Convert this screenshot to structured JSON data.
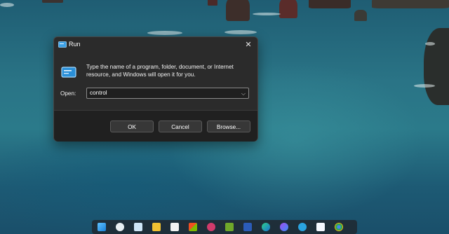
{
  "window": {
    "title": "Run",
    "close_glyph": "✕",
    "description": "Type the name of a program, folder, document, or Internet resource, and Windows will open it for you.",
    "open_label": "Open:",
    "open_value": "control",
    "dropdown_glyph": "⌵"
  },
  "buttons": {
    "ok": "OK",
    "cancel": "Cancel",
    "browse": "Browse..."
  },
  "taskbar": {
    "icons": [
      "start-icon",
      "weather-icon",
      "notepad-icon",
      "file-explorer-icon",
      "snipping-icon",
      "store-icon",
      "photos-icon",
      "vim-icon",
      "word-icon",
      "edge-icon",
      "messenger-icon",
      "telegram-icon",
      "zalo-icon",
      "chrome-icon"
    ]
  },
  "colors": {
    "dialog_bg": "#2b2b2b",
    "footer_bg": "#202020",
    "accent": "#0078d4",
    "water": "#2a7486"
  }
}
